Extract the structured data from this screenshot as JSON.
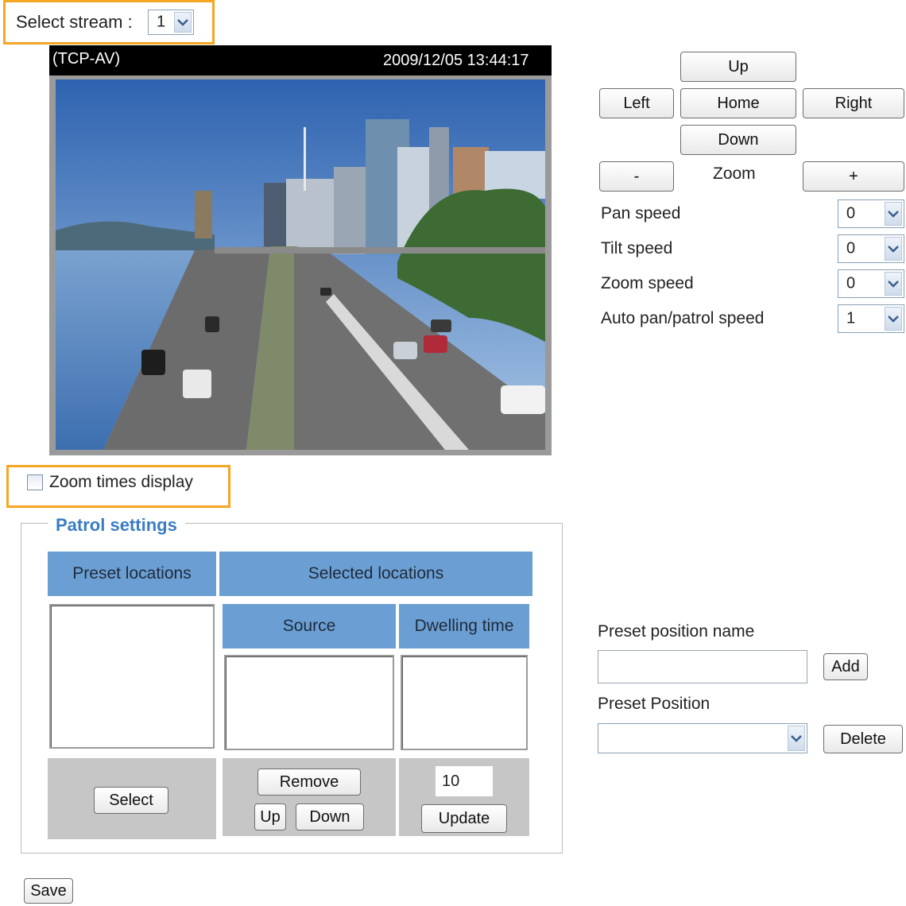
{
  "stream": {
    "label": "Select stream :",
    "value": "1"
  },
  "video": {
    "protocol": "(TCP-AV)",
    "timestamp": "2009/12/05 13:44:17"
  },
  "ptz": {
    "up": "Up",
    "left": "Left",
    "home": "Home",
    "right": "Right",
    "down": "Down",
    "zoom_out": "-",
    "zoom_label": "Zoom",
    "zoom_in": "+"
  },
  "speeds": [
    {
      "label": "Pan speed",
      "value": "0"
    },
    {
      "label": "Tilt speed",
      "value": "0"
    },
    {
      "label": "Zoom speed",
      "value": "0"
    },
    {
      "label": "Auto pan/patrol speed",
      "value": "1"
    }
  ],
  "zoom_display": {
    "label": "Zoom times display",
    "checked": false
  },
  "patrol": {
    "title": "Patrol settings",
    "preset_locations": "Preset locations",
    "selected_locations": "Selected locations",
    "source": "Source",
    "dwelling_time": "Dwelling time",
    "select": "Select",
    "remove": "Remove",
    "up": "Up",
    "down": "Down",
    "dwell_value": "10",
    "update": "Update"
  },
  "preset": {
    "name_label": "Preset position name",
    "name_value": "",
    "add": "Add",
    "position_label": "Preset Position",
    "position_value": "",
    "delete": "Delete"
  },
  "save": "Save",
  "colors": {
    "highlight": "#f5a623",
    "header_blue": "#6b9fd4",
    "title_blue": "#3a7cc4"
  }
}
